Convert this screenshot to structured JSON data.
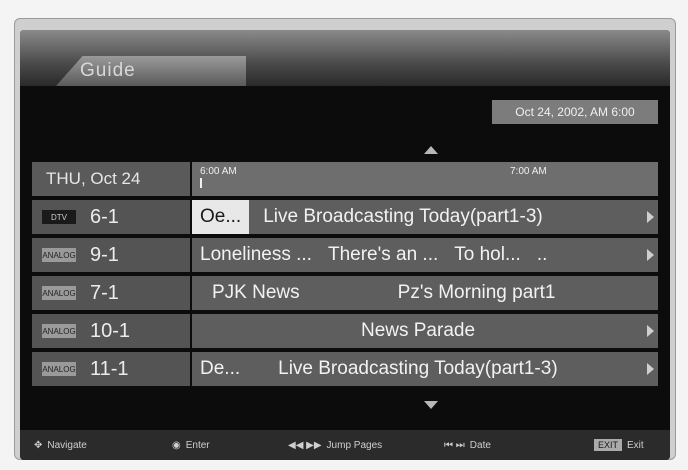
{
  "header": {
    "title": "Guide"
  },
  "datetime": "Oct 24, 2002, AM 6:00",
  "grid": {
    "date_label": "THU, Oct 24",
    "times": [
      "6:00 AM",
      "7:00 AM"
    ],
    "rows": [
      {
        "badge": "DTV",
        "channel": "6-1",
        "programs": [
          "Oe...",
          "Live Broadcasting Today(part1-3)"
        ],
        "more": true
      },
      {
        "badge": "ANALOG",
        "channel": "9-1",
        "programs": [
          "Loneliness ...",
          "There's an ...",
          "To hol...",
          ".."
        ],
        "more": true
      },
      {
        "badge": "ANALOG",
        "channel": "7-1",
        "programs": [
          "PJK News",
          "Pz's Morning part1"
        ],
        "more": false
      },
      {
        "badge": "ANALOG",
        "channel": "10-1",
        "programs": [
          "News Parade"
        ],
        "more": true
      },
      {
        "badge": "ANALOG",
        "channel": "11-1",
        "programs": [
          "De...",
          "Live Broadcasting Today(part1-3)"
        ],
        "more": true
      }
    ]
  },
  "footer": {
    "navigate": "Navigate",
    "enter": "Enter",
    "jump": "Jump Pages",
    "date": "Date",
    "exit_key": "EXIT",
    "exit": "Exit"
  }
}
